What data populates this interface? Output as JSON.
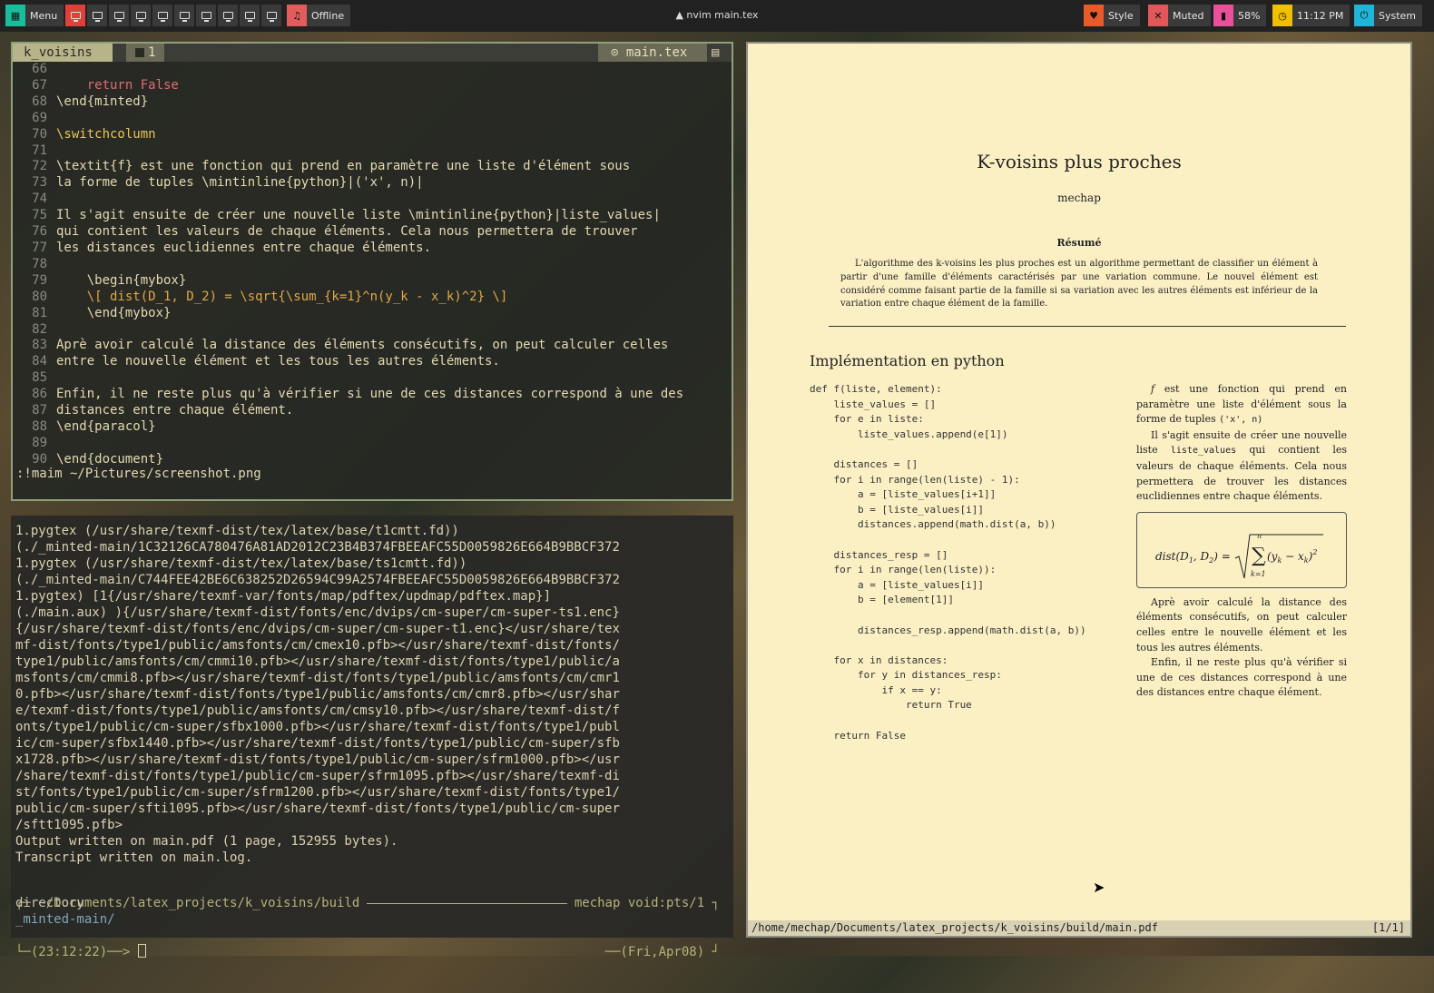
{
  "topbar": {
    "menu_label": "Menu",
    "workspace_count": 10,
    "offline_label": "Offline",
    "window_title": "nvim main.tex",
    "style_label": "Style",
    "muted_label": "Muted",
    "battery_label": "58%",
    "clock_label": "11:12 PM",
    "system_label": "System",
    "colors": {
      "menu": "#1abc9c",
      "ws_active": "#e0403a",
      "offline": "#e25c5c",
      "style": "#e85a2a",
      "muted": "#e0585a",
      "battery": "#e8509a",
      "clock": "#f0c000",
      "system": "#1fb4d8"
    }
  },
  "editor": {
    "tab_name": "k_voisins",
    "buffer_num": "1",
    "file_name": "main.tex",
    "lines": [
      {
        "n": "66",
        "t": ""
      },
      {
        "n": "67",
        "t": "    return False"
      },
      {
        "n": "68",
        "t": "\\end{minted}"
      },
      {
        "n": "69",
        "t": ""
      },
      {
        "n": "70",
        "t": "\\switchcolumn"
      },
      {
        "n": "71",
        "t": ""
      },
      {
        "n": "72",
        "t": "\\textit{f} est une fonction qui prend en paramètre une liste d'élément sous"
      },
      {
        "n": "73",
        "t": "la forme de tuples \\mintinline{python}|('x', n)|"
      },
      {
        "n": "74",
        "t": ""
      },
      {
        "n": "75",
        "t": "Il s'agit ensuite de créer une nouvelle liste \\mintinline{python}|liste_values|"
      },
      {
        "n": "76",
        "t": "qui contient les valeurs de chaque éléments. Cela nous permettera de trouver"
      },
      {
        "n": "77",
        "t": "les distances euclidiennes entre chaque éléments."
      },
      {
        "n": "78",
        "t": ""
      },
      {
        "n": "79",
        "t": "    \\begin{mybox}"
      },
      {
        "n": "80",
        "t": "    \\[ dist(D_1, D_2) = \\sqrt{\\sum_{k=1}^n(y_k - x_k)^2} \\]"
      },
      {
        "n": "81",
        "t": "    \\end{mybox}"
      },
      {
        "n": "82",
        "t": ""
      },
      {
        "n": "83",
        "t": "Aprè avoir calculé la distance des éléments consécutifs, on peut calculer celles"
      },
      {
        "n": "84",
        "t": "entre le nouvelle élément et les tous les autres éléments."
      },
      {
        "n": "85",
        "t": ""
      },
      {
        "n": "86",
        "t": "Enfin, il ne reste plus qu'à vérifier si une de ces distances correspond à une des"
      },
      {
        "n": "87",
        "t": "distances entre chaque élément."
      },
      {
        "n": "88",
        "t": "\\end{paracol}"
      },
      {
        "n": "89",
        "t": ""
      },
      {
        "n": "90",
        "t": "\\end{document}"
      }
    ],
    "command_line": ":!maim ~/Pictures/screenshot.png"
  },
  "terminal": {
    "output": "1.pygtex (/usr/share/texmf-dist/tex/latex/base/t1cmtt.fd))\n(./_minted-main/1C32126CA780476A81AD2012C23B4B374FBEEAFC55D0059826E664B9BBCF372\n1.pygtex (/usr/share/texmf-dist/tex/latex/base/ts1cmtt.fd))\n(./_minted-main/C744FEE42BE6C638252D26594C99A2574FBEEAFC55D0059826E664B9BBCF372\n1.pygtex) [1{/usr/share/texmf-var/fonts/map/pdftex/updmap/pdftex.map}]\n(./main.aux) ){/usr/share/texmf-dist/fonts/enc/dvips/cm-super/cm-super-ts1.enc}\n{/usr/share/texmf-dist/fonts/enc/dvips/cm-super/cm-super-t1.enc}</usr/share/tex\nmf-dist/fonts/type1/public/amsfonts/cm/cmex10.pfb></usr/share/texmf-dist/fonts/\ntype1/public/amsfonts/cm/cmmi10.pfb></usr/share/texmf-dist/fonts/type1/public/a\nmsfonts/cm/cmmi8.pfb></usr/share/texmf-dist/fonts/type1/public/amsfonts/cm/cmr1\n0.pfb></usr/share/texmf-dist/fonts/type1/public/amsfonts/cm/cmr8.pfb></usr/shar\ne/texmf-dist/fonts/type1/public/amsfonts/cm/cmsy10.pfb></usr/share/texmf-dist/f\nonts/type1/public/cm-super/sfbx1000.pfb></usr/share/texmf-dist/fonts/type1/publ\nic/cm-super/sfbx1440.pfb></usr/share/texmf-dist/fonts/type1/public/cm-super/sfb\nx1728.pfb></usr/share/texmf-dist/fonts/type1/public/cm-super/sfrm1000.pfb></usr\n/share/texmf-dist/fonts/type1/public/cm-super/sfrm1095.pfb></usr/share/texmf-di\nst/fonts/type1/public/cm-super/sfrm1200.pfb></usr/share/texmf-dist/fonts/type1/\npublic/cm-super/sfti1095.pfb></usr/share/texmf-dist/fonts/type1/public/cm-super\n/sftt1095.pfb>\nOutput written on main.pdf (1 page, 152955 bytes).\nTranscript written on main.log.",
    "prompt_path": "~/Documents/latex_projects/k_voisins/build",
    "prompt_host": "mechap void:pts/1",
    "prompt_time": "(23:12:22)",
    "prompt_date": "(Fri,Apr08)",
    "completion_header": "directory",
    "completion_item": "_minted-main/"
  },
  "viewer": {
    "title": "K-voisins plus proches",
    "author": "mechap",
    "abstract_heading": "Résumé",
    "abstract_text": "L'algorithme des k-voisins les plus proches est un algorithme permettant de classifier un élément à partir d'une famille d'éléments caractérisés par une variation commune. Le nouvel élément est considéré comme faisant partie de la famille si sa variation avec les autres éléments est inférieur de la variation entre chaque élément de la famille.",
    "section_heading": "Implémentation en python",
    "code": "def f(liste, element):\n    liste_values = []\n    for e in liste:\n        liste_values.append(e[1])\n\n    distances = []\n    for i in range(len(liste) - 1):\n        a = [liste_values[i+1]]\n        b = [liste_values[i]]\n        distances.append(math.dist(a, b))\n\n    distances_resp = []\n    for i in range(len(liste)):\n        a = [liste_values[i]]\n        b = [element[1]]\n\n        distances_resp.append(math.dist(a, b))\n\n    for x in distances:\n        for y in distances_resp:\n            if x == y:\n                return True\n\n    return False",
    "para1_italic": "f",
    "para1": " est une fonction qui prend en paramètre une liste d'élément sous la forme de tuples ",
    "para1_code": "('x', n)",
    "para2_start": "Il s'agit ensuite de créer une nouvelle liste ",
    "para2_code": "liste_values",
    "para2_end": " qui contient les valeurs de chaque éléments. Cela nous permettera de trouver les distances euclidiennes entre chaque éléments.",
    "formula_lhs": "dist(D",
    "para3": "Aprè avoir calculé la distance des éléments consécutifs, on peut calculer celles entre le nouvelle élément et les tous les autres éléments.",
    "para4": "Enfin, il ne reste plus qu'à vérifier si une de ces distances correspond à une des distances entre chaque élément.",
    "status_path": "/home/mechap/Documents/latex_projects/k_voisins/build/main.pdf",
    "status_page": "[1/1]"
  }
}
